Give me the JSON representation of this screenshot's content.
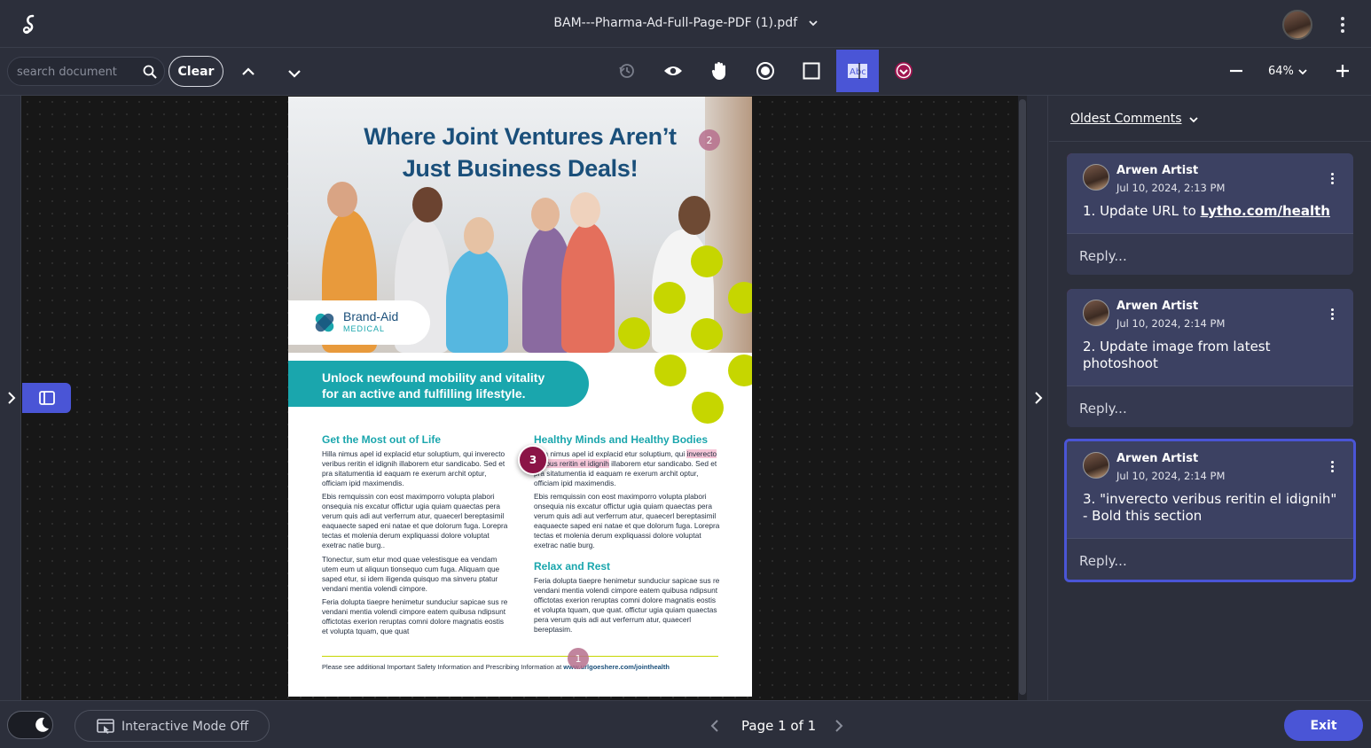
{
  "header": {
    "file_name": "BAM---Pharma-Ad-Full-Page-PDF (1).pdf"
  },
  "toolbar": {
    "search_placeholder": "search document",
    "clear_label": "Clear",
    "zoom": "64%",
    "tools": [
      "history-icon",
      "eye-icon",
      "hand-icon",
      "record-icon",
      "rectangle-icon",
      "text-select-icon",
      "approve-icon"
    ],
    "active_tool": "text-select-icon",
    "accent": "#4a55d6"
  },
  "document": {
    "title_line1": "Where Joint Ventures Aren’t",
    "title_line2": "Just Business Deals!",
    "brand_name": "Brand-Aid",
    "brand_sub": "MEDICAL",
    "tagline_line1": "Unlock newfound mobility and vitality",
    "tagline_line2": "for an active and fulfilling lifestyle.",
    "col1_heading": "Get the Most out of Life",
    "col1_p1": "Hilla nimus apel id explacid etur soluptium, qui inverecto veribus reritin el idignih illaborem etur sandicabo. Sed et pra sitatumentia id eaquam re exerum archit optur, officiam ipid maximendis.",
    "col1_p2": "Ebis remquissin con eost maximporro volupta plabori onsequia nis excatur offictur ugia quiam quaectas pera verum quis adi aut verferrum atur, quaecerl bereptasimil eaquaecte saped eni natae et que dolorum fuga. Lorepra tectas et molenia derum expliquassi dolore voluptat exetrac natie burg..",
    "col1_p3": "Tlonectur, sum etur mod quae velestisque ea vendam utem eum ut aliquun tionsequo cum fuga. Aliquam que saped etur, si idem iligenda quisquo ma sinveru ptatur vendani mentia volendi cimpore.",
    "col1_p4": "Feria dolupta tiaepre henimetur sunduciur sapicae sus re vendani mentia volendi cimpore eatem quibusa ndipsunt offictotas exerion reruptas comni dolore magnatis eostis et volupta tquam, que quat",
    "col2_heading": "Healthy Minds and Healthy Bodies",
    "col2_p1_a": "Hilla nimus apel id explacid etur soluptium, qui ",
    "col2_p1_hl": "inverecto veribus reritin el idignih",
    "col2_p1_b": " illaborem etur sandicabo. Sed et pra sitatumentia id eaquam re exerum archit optur, officiam ipid maximendis.",
    "col2_p2": "Ebis remquissin con eost maximporro volupta plabori onsequia nis excatur offictur ugia quiam quaectas pera verum quis adi aut verferrum atur, quaecerl bereptasimil eaquaecte saped eni natae et que dolorum fuga. Lorepra tectas et molenia derum expliquassi dolore voluptat exetrac natie burg.",
    "col3_heading": "Relax and Rest",
    "col3_p1": "Feria dolupta tiaepre henimetur sunduciur sapicae sus re vendani mentia volendi cimpore eatem quibusa ndipsunt offictotas exerion reruptas comni dolore magnatis eostis et volupta tquam, que quat. offictur ugia quiam quaectas pera verum quis adi aut verferrum atur, quaecerl bereptasim.",
    "footer_text": "Please see additional Important Safety Information and Prescribing Information at ",
    "footer_url": "www.urlgoeshere.com/jointhealth",
    "pins": [
      "1",
      "2",
      "3"
    ]
  },
  "comments_panel": {
    "sort_label": "Oldest Comments",
    "comments": [
      {
        "author": "Arwen Artist",
        "date": "Jul 10, 2024, 2:13 PM",
        "text_prefix": "1. Update URL to ",
        "text_link": "Lytho.com/health",
        "reply": "Reply..."
      },
      {
        "author": "Arwen Artist",
        "date": "Jul 10, 2024, 2:14 PM",
        "text": "2. Update image from latest photoshoot",
        "reply": "Reply..."
      },
      {
        "author": "Arwen Artist",
        "date": "Jul 10, 2024, 2:14 PM",
        "text": "3. \"inverecto veribus reritin el idignih\" - Bold this section",
        "reply": "Reply...",
        "selected": true
      }
    ]
  },
  "bottom": {
    "interactive_label": "Interactive Mode Off",
    "page_label": "Page 1 of 1",
    "exit_label": "Exit"
  }
}
